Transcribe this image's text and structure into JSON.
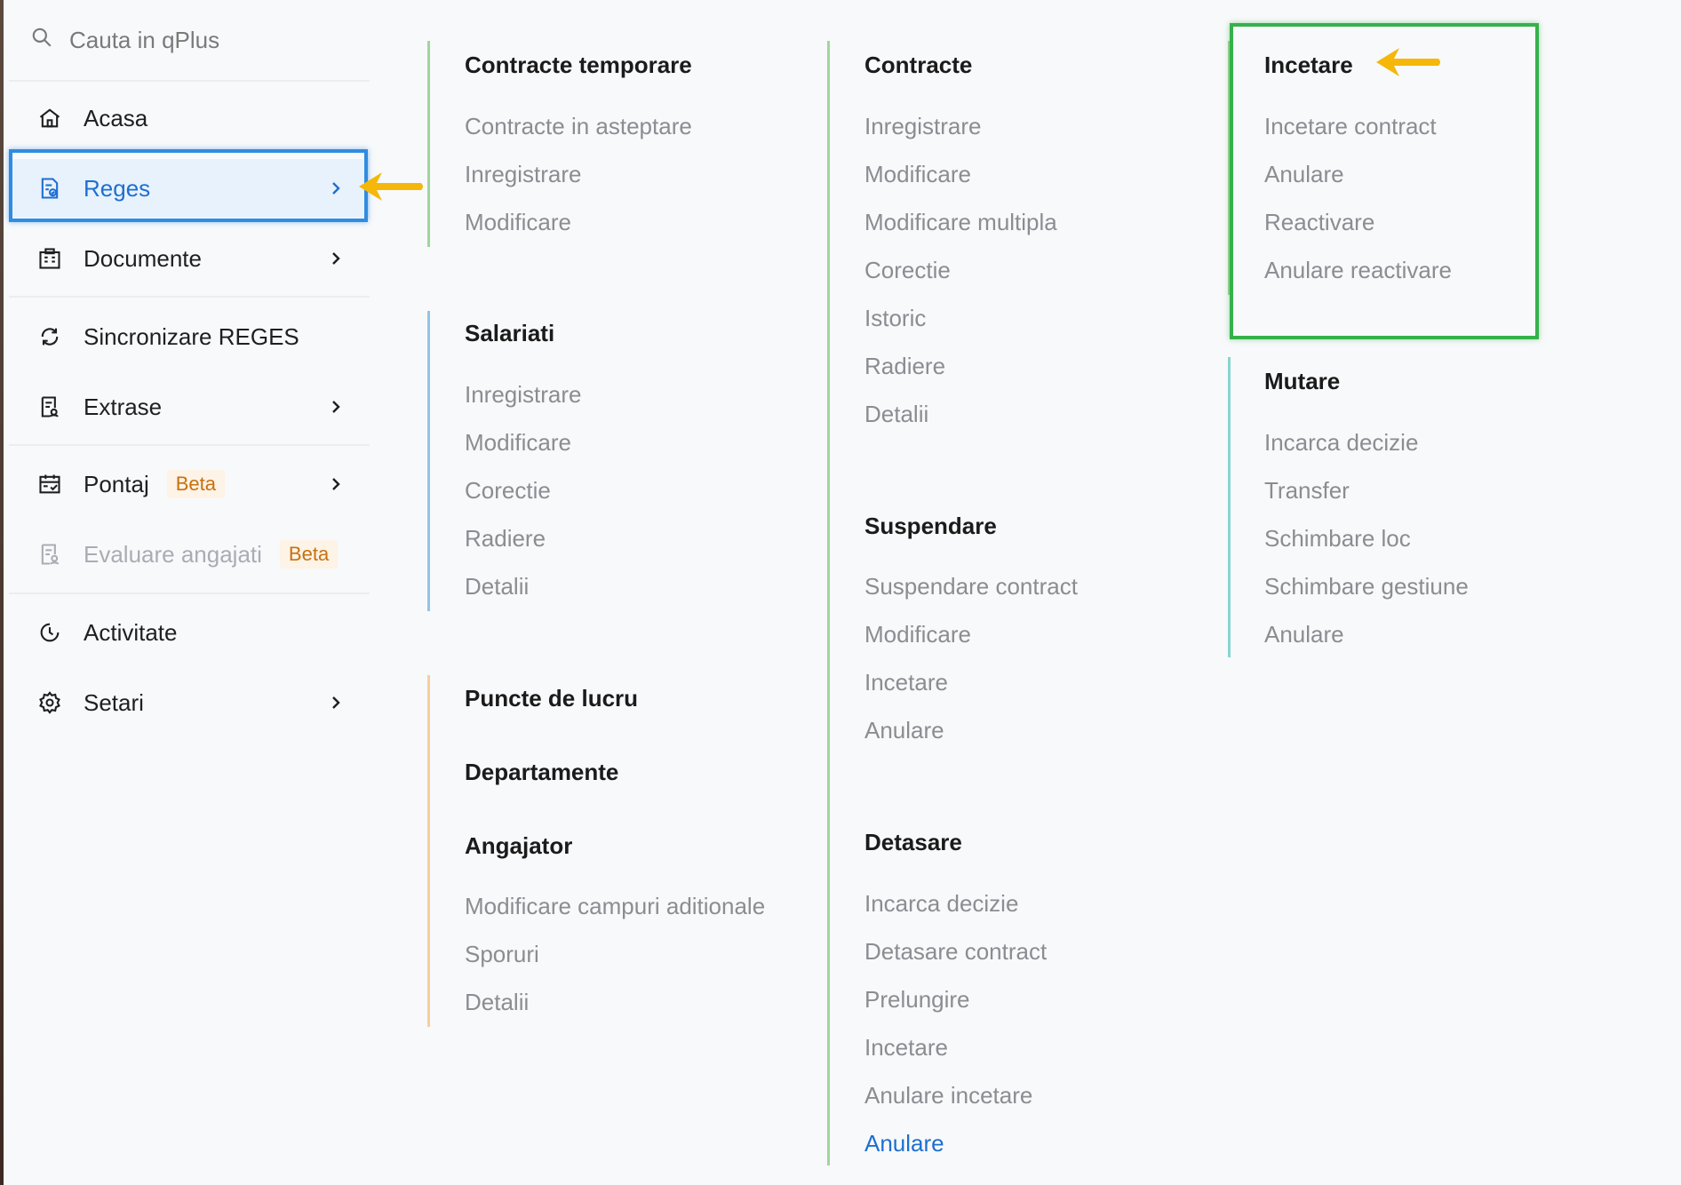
{
  "search": {
    "placeholder": "Cauta in qPlus"
  },
  "sidebar": {
    "items": [
      {
        "label": "Acasa"
      },
      {
        "label": "Reges"
      },
      {
        "label": "Documente"
      },
      {
        "label": "Sincronizare REGES"
      },
      {
        "label": "Extrase"
      },
      {
        "label": "Pontaj",
        "badge": "Beta"
      },
      {
        "label": "Evaluare angajati",
        "badge": "Beta"
      },
      {
        "label": "Activitate"
      },
      {
        "label": "Setari"
      }
    ]
  },
  "menu": {
    "col1": {
      "contracte_temporare": {
        "title": "Contracte temporare",
        "links": [
          "Contracte in asteptare",
          "Inregistrare",
          "Modificare"
        ]
      },
      "salariati": {
        "title": "Salariati",
        "links": [
          "Inregistrare",
          "Modificare",
          "Corectie",
          "Radiere",
          "Detalii"
        ]
      },
      "puncte": {
        "title": "Puncte de lucru"
      },
      "departamente": {
        "title": "Departamente"
      },
      "angajator": {
        "title": "Angajator",
        "links": [
          "Modificare campuri aditionale",
          "Sporuri",
          "Detalii"
        ]
      }
    },
    "col2": {
      "contracte": {
        "title": "Contracte",
        "links": [
          "Inregistrare",
          "Modificare",
          "Modificare multipla",
          "Corectie",
          "Istoric",
          "Radiere",
          "Detalii"
        ]
      },
      "suspendare": {
        "title": "Suspendare",
        "links": [
          "Suspendare contract",
          "Modificare",
          "Incetare",
          "Anulare"
        ]
      },
      "detasare": {
        "title": "Detasare",
        "links": [
          "Incarca decizie",
          "Detasare contract",
          "Prelungire",
          "Incetare",
          "Anulare incetare",
          "Anulare"
        ]
      }
    },
    "col3": {
      "incetare": {
        "title": "Incetare",
        "links": [
          "Incetare contract",
          "Anulare",
          "Reactivare",
          "Anulare reactivare"
        ]
      },
      "mutare": {
        "title": "Mutare",
        "links": [
          "Incarca decizie",
          "Transfer",
          "Schimbare loc",
          "Schimbare gestiune",
          "Anulare"
        ]
      }
    }
  },
  "colors": {
    "active_blue": "#1e6fd0",
    "highlight_blue": "#2f8ce0",
    "highlight_green": "#35b14a",
    "arrow": "#f5b70a",
    "line_green": "#9fd69a",
    "line_blue": "#8fc5e8",
    "line_orange": "#f6cf9b",
    "line_teal": "#86d5d0"
  }
}
